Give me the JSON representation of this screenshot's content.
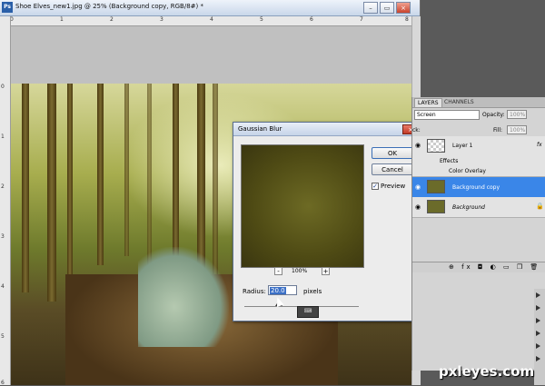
{
  "document": {
    "title": "Shoe Elves_new1.jpg @ 25% (Background copy, RGB/8#) *",
    "app_icon": "Ps",
    "ruler_top_ticks": [
      "0",
      "1",
      "2",
      "3",
      "4",
      "5",
      "6",
      "7",
      "8"
    ],
    "ruler_left_ticks": [
      "0",
      "1",
      "2",
      "3",
      "4",
      "5",
      "6"
    ]
  },
  "dialog": {
    "title": "Gaussian Blur",
    "ok_label": "OK",
    "cancel_label": "Cancel",
    "preview_label": "Preview",
    "preview_checked": "✓",
    "zoom_minus": "-",
    "zoom_plus": "+",
    "zoom_level": "100%",
    "radius_label": "Radius:",
    "radius_value": "20.0",
    "radius_unit": "pixels"
  },
  "layers_panel": {
    "tab_layers": "LAYERS",
    "tab_channels": "CHANNELS",
    "blend_mode": "Screen",
    "opacity_label": "Opacity:",
    "opacity_value": "100%",
    "lock_label": "ck:",
    "fill_label": "Fill:",
    "fill_value": "100%",
    "layers": [
      {
        "name": "Layer 1",
        "fx": "fx"
      },
      {
        "name": "Effects"
      },
      {
        "name": "Color Overlay"
      },
      {
        "name": "Background copy"
      },
      {
        "name": "Background"
      }
    ],
    "footer_icons": "⊕ fx ◘ ◐ ▭ ❒ 🗑"
  },
  "watermark": "pxleyes.com",
  "colors": {
    "selected_row": "#3a86e8",
    "title_gradient": "#c9d7ea"
  }
}
